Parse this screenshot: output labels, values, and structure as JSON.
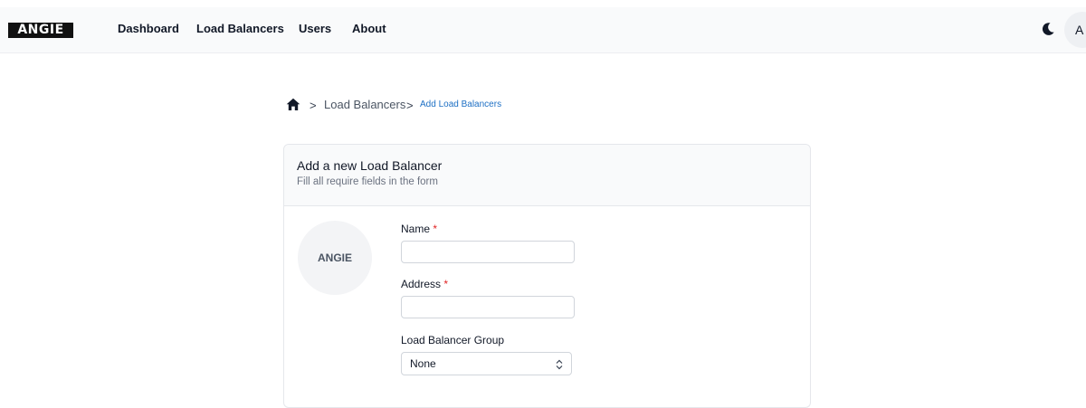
{
  "brand": {
    "logo_text": "ANGIE"
  },
  "nav": {
    "items": [
      {
        "label": "Dashboard"
      },
      {
        "label": "Load Balancers"
      },
      {
        "label": "Users"
      },
      {
        "label": "About"
      }
    ],
    "theme_toggle_icon": "moon-icon",
    "avatar_initial": "A"
  },
  "breadcrumb": {
    "home_icon": "home-icon",
    "items": [
      {
        "label": "Load Balancers"
      },
      {
        "label": "Add Load Balancers"
      }
    ],
    "separator": ">"
  },
  "form": {
    "title": "Add a new Load Balancer",
    "subtitle": "Fill all require fields in the form",
    "logo_placeholder": "ANGIE",
    "required_mark": "*",
    "fields": {
      "name": {
        "label": "Name",
        "value": ""
      },
      "address": {
        "label": "Address",
        "value": ""
      },
      "group": {
        "label": "Load Balancer Group",
        "value": "None"
      }
    }
  },
  "colors": {
    "accent": "#1d6fc4",
    "required": "#e02424",
    "header_bg": "#f9fafb"
  }
}
